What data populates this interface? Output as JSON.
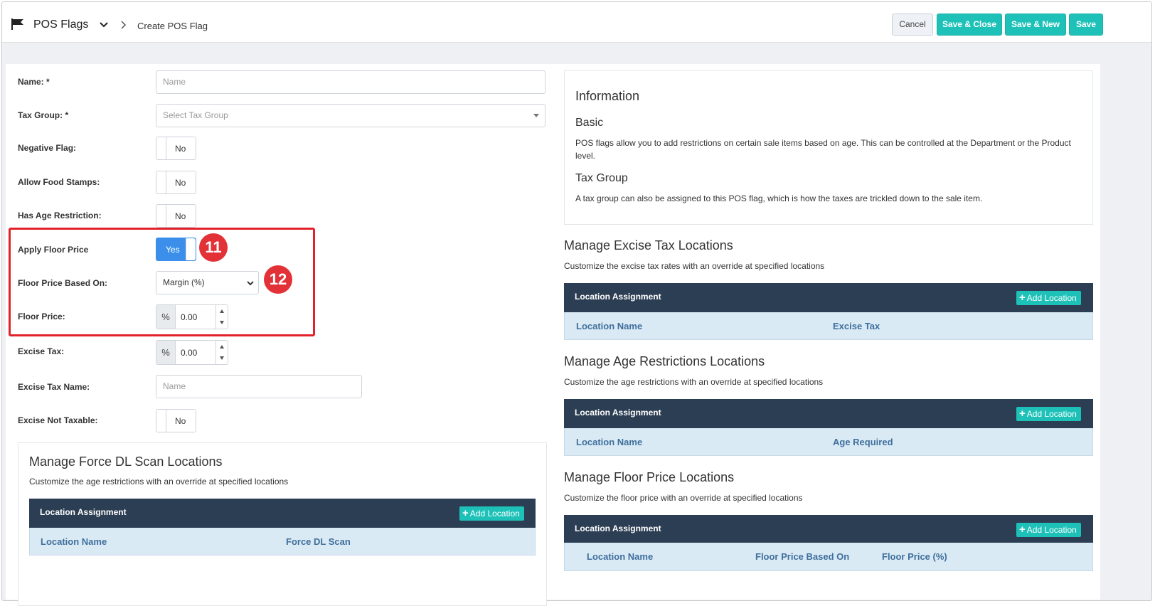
{
  "header": {
    "title": "POS Flags",
    "breadcrumb_current": "Create POS Flag",
    "buttons": {
      "cancel": "Cancel",
      "save_close": "Save & Close",
      "save_new": "Save & New",
      "save": "Save"
    }
  },
  "form": {
    "name_label": "Name: *",
    "name_placeholder": "Name",
    "tax_group_label": "Tax Group: *",
    "tax_group_placeholder": "Select Tax Group",
    "negative_flag_label": "Negative Flag:",
    "negative_flag_value": "No",
    "food_stamps_label": "Allow Food Stamps:",
    "food_stamps_value": "No",
    "age_restriction_label": "Has Age Restriction:",
    "age_restriction_value": "No",
    "apply_floor_label": "Apply Floor Price",
    "apply_floor_value": "Yes",
    "floor_based_label": "Floor Price Based On:",
    "floor_based_value": "Margin (%)",
    "floor_price_label": "Floor Price:",
    "floor_price_addon": "%",
    "floor_price_value": "0.00",
    "excise_tax_label": "Excise Tax:",
    "excise_tax_addon": "%",
    "excise_tax_value": "0.00",
    "excise_name_label": "Excise Tax Name:",
    "excise_name_placeholder": "Name",
    "excise_not_taxable_label": "Excise Not Taxable:",
    "excise_not_taxable_value": "No"
  },
  "markers": {
    "m11": "11",
    "m12": "12"
  },
  "force_dl": {
    "title": "Manage Force DL Scan Locations",
    "desc": "Customize the age restrictions with an override at specified locations",
    "table_title": "Location Assignment",
    "add_label": "Add Location",
    "cols": [
      "Location Name",
      "Force DL Scan"
    ]
  },
  "info": {
    "title": "Information",
    "basic_title": "Basic",
    "basic_text": "POS flags allow you to add restrictions on certain sale items based on age. This can be controlled at the Department or the Product level.",
    "tax_title": "Tax Group",
    "tax_text": "A tax group can also be assigned to this POS flag, which is how the taxes are trickled down to the sale item."
  },
  "excise": {
    "title": "Manage Excise Tax Locations",
    "desc": "Customize the excise tax rates with an override at specified locations",
    "table_title": "Location Assignment",
    "add_label": "Add Location",
    "cols": [
      "Location Name",
      "Excise Tax"
    ]
  },
  "age": {
    "title": "Manage Age Restrictions Locations",
    "desc": "Customize the age restrictions with an override at specified locations",
    "table_title": "Location Assignment",
    "add_label": "Add Location",
    "cols": [
      "Location Name",
      "Age Required"
    ]
  },
  "floor": {
    "title": "Manage Floor Price Locations",
    "desc": "Customize the floor price with an override at specified locations",
    "table_title": "Location Assignment",
    "add_label": "Add Location",
    "cols": [
      "Location Name",
      "Floor Price Based On",
      "Floor Price (%)"
    ]
  },
  "colors": {
    "accent": "#1ec1b8",
    "toggle_on": "#3b8fea",
    "table_header": "#2c3e53",
    "highlight": "#e2222b"
  }
}
